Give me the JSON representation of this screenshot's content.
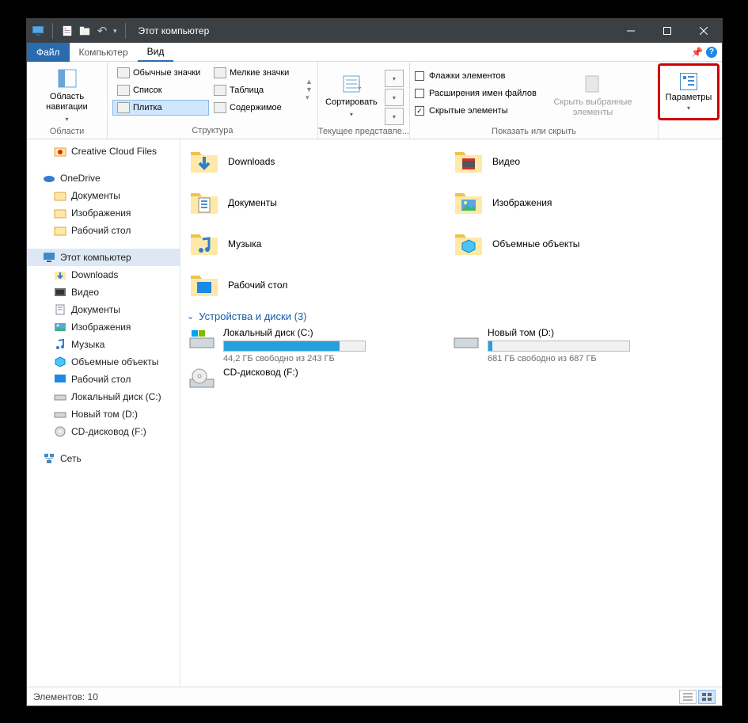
{
  "title": "Этот компьютер",
  "tabs": {
    "file": "Файл",
    "computer": "Компьютер",
    "view": "Вид"
  },
  "ribbon": {
    "nav_area": "Область навигации",
    "nav_sublabel": "Области",
    "layout": {
      "normal": "Обычные значки",
      "small": "Мелкие значки",
      "list": "Список",
      "table": "Таблица",
      "tiles": "Плитка",
      "content": "Содержимое",
      "group_label": "Структура"
    },
    "sort": "Сортировать",
    "current_view": "Текущее представле...",
    "chk_flags": "Флажки элементов",
    "chk_ext": "Расширения имен файлов",
    "chk_hidden": "Скрытые элементы",
    "hide_selected": "Скрыть выбранные элементы",
    "params": "Параметры",
    "show_hide": "Показать или скрыть"
  },
  "tree": {
    "creative": "Creative Cloud Files",
    "onedrive": "OneDrive",
    "od_docs": "Документы",
    "od_imgs": "Изображения",
    "od_desk": "Рабочий стол",
    "thispc": "Этот компьютер",
    "downloads": "Downloads",
    "video": "Видео",
    "docs": "Документы",
    "imgs": "Изображения",
    "music": "Музыка",
    "objects3d": "Объемные объекты",
    "desk": "Рабочий стол",
    "diskc": "Локальный диск (C:)",
    "diskd": "Новый том (D:)",
    "cdrom": "CD-дисковод (F:)",
    "network": "Сеть"
  },
  "folders": {
    "downloads": "Downloads",
    "video": "Видео",
    "docs": "Документы",
    "imgs": "Изображения",
    "music": "Музыка",
    "objects3d": "Объемные объекты",
    "desk": "Рабочий стол"
  },
  "devices_hdr": "Устройства и диски (3)",
  "drives": {
    "c": {
      "name": "Локальный диск (C:)",
      "sub": "44,2 ГБ свободно из 243 ГБ",
      "fill": "82%"
    },
    "d": {
      "name": "Новый том (D:)",
      "sub": "681 ГБ свободно из 687 ГБ",
      "fill": "3%"
    },
    "f": {
      "name": "CD-дисковод (F:)"
    }
  },
  "status": "Элементов: 10"
}
